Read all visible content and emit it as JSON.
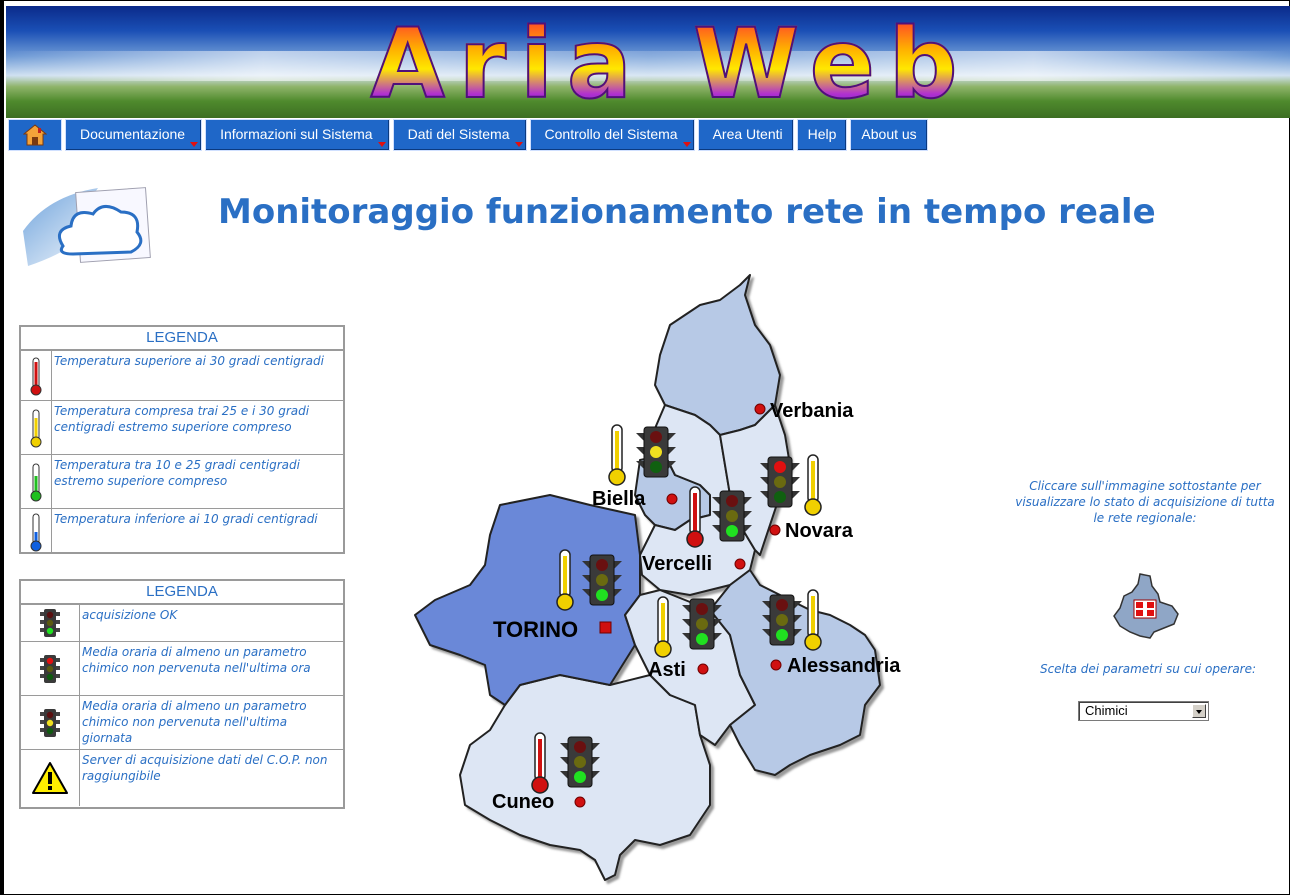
{
  "banner": {
    "title": "Aria Web"
  },
  "menu": {
    "home_icon": "home-icon",
    "items": [
      {
        "label": "Documentazione",
        "has_submenu": true
      },
      {
        "label": "Informazioni sul Sistema",
        "has_submenu": true
      },
      {
        "label": "Dati del Sistema",
        "has_submenu": true
      },
      {
        "label": "Controllo del Sistema",
        "has_submenu": true
      },
      {
        "label": "Area Utenti",
        "has_submenu": false
      },
      {
        "label": "Help",
        "has_submenu": false
      },
      {
        "label": "About us",
        "has_submenu": false
      }
    ]
  },
  "page": {
    "title": "Monitoraggio funzionamento rete in tempo reale"
  },
  "legend_temperature": {
    "title": "LEGENDA",
    "items": [
      {
        "icon": "thermometer-red-icon",
        "text": "Temperatura superiore ai 30 gradi centigradi"
      },
      {
        "icon": "thermometer-yellow-icon",
        "text": "Temperatura compresa trai 25 e i 30 gradi centigradi estremo superiore compreso"
      },
      {
        "icon": "thermometer-green-icon",
        "text": "Temperatura tra 10 e 25 gradi centigradi estremo superiore compreso"
      },
      {
        "icon": "thermometer-blue-icon",
        "text": "Temperatura inferiore ai 10 gradi centigradi"
      }
    ]
  },
  "legend_acquisition": {
    "title": "LEGENDA",
    "items": [
      {
        "icon": "traffic-light-green-icon",
        "text": "acquisizione OK"
      },
      {
        "icon": "traffic-light-red-icon",
        "text": "Media oraria di almeno un parametro chimico non pervenuta nell'ultima ora"
      },
      {
        "icon": "traffic-light-yellow-icon",
        "text": "Media oraria di almeno un parametro chimico non pervenuta nell'ultima giornata"
      },
      {
        "icon": "warning-icon",
        "text": "Server di acquisizione dati del C.O.P. non raggiungibile"
      }
    ]
  },
  "map": {
    "provinces": [
      {
        "name": "Verbania",
        "thermometer": "",
        "light": ""
      },
      {
        "name": "Biella",
        "thermometer": "yellow",
        "light": "yellow"
      },
      {
        "name": "Novara",
        "thermometer": "yellow",
        "light": "red"
      },
      {
        "name": "Vercelli",
        "thermometer": "red",
        "light": "green"
      },
      {
        "name": "TORINO",
        "thermometer": "yellow",
        "light": "green"
      },
      {
        "name": "Asti",
        "thermometer": "yellow",
        "light": "green"
      },
      {
        "name": "Alessandria",
        "thermometer": "yellow",
        "light": "green"
      },
      {
        "name": "Cuneo",
        "thermometer": "red",
        "light": "green"
      }
    ]
  },
  "sidebar": {
    "click_note": "Cliccare sull'immagine sottostante per visualizzare lo stato di acquisizione di tutta le rete regionale:",
    "param_label": "Scelta dei parametri su cui operare:",
    "param_value": "Chimici"
  },
  "colors": {
    "link_blue": "#2a6fc4",
    "menu_bg": "#1f67c8",
    "region_light": "#dde6f4",
    "region_mid": "#b7c9e6",
    "region_dark": "#6a88d8"
  }
}
